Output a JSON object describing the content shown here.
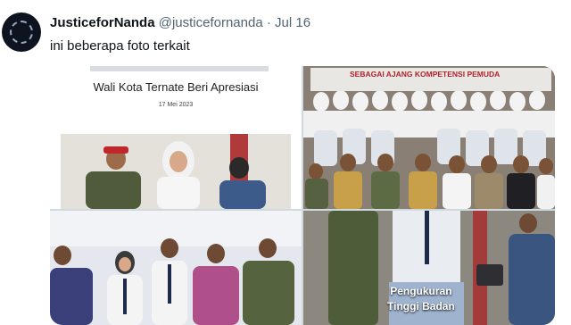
{
  "tweet": {
    "display_name": "JusticeforNanda",
    "handle": "@justicefornanda",
    "separator": "·",
    "date": "Jul 16",
    "text": "ini beberapa foto terkait"
  },
  "media": {
    "image1": {
      "title": "Wali Kota Ternate Beri Apresiasi",
      "date": "17 Mei 2023"
    },
    "image2": {
      "banner": "SEBAGAI AJANG KOMPETENSI PEMUDA"
    },
    "image4": {
      "caption_line1": "Pengukuran",
      "caption_line2": "Tinggi Badan"
    }
  }
}
